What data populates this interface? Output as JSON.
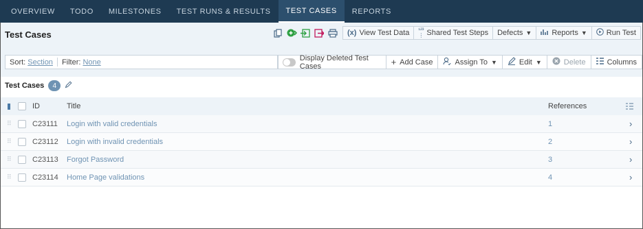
{
  "nav": {
    "tabs": [
      {
        "label": "OVERVIEW"
      },
      {
        "label": "TODO"
      },
      {
        "label": "MILESTONES"
      },
      {
        "label": "TEST RUNS & RESULTS"
      },
      {
        "label": "TEST CASES",
        "active": true
      },
      {
        "label": "REPORTS"
      }
    ]
  },
  "header": {
    "title": "Test Cases",
    "icons": [
      "copy-icon",
      "add-case-icon",
      "import-icon",
      "export-icon",
      "print-icon"
    ],
    "view_test_data": "View Test Data",
    "shared_test_steps": "Shared Test Steps",
    "defects": "Defects",
    "reports": "Reports",
    "run_test": "Run Test"
  },
  "toolbar": {
    "sort_label": "Sort:",
    "sort_value": "Section",
    "filter_label": "Filter:",
    "filter_value": "None",
    "display_deleted": "Display Deleted Test Cases",
    "add_case": "Add Case",
    "assign_to": "Assign To",
    "edit": "Edit",
    "delete": "Delete",
    "columns": "Columns"
  },
  "section": {
    "title": "Test Cases",
    "count": "4"
  },
  "table": {
    "headers": {
      "id": "ID",
      "title": "Title",
      "references": "References"
    },
    "rows": [
      {
        "id": "C23111",
        "title": "Login with valid credentials",
        "ref": "1"
      },
      {
        "id": "C23112",
        "title": "Login with invalid credentials",
        "ref": "2"
      },
      {
        "id": "C23113",
        "title": "Forgot Password",
        "ref": "3"
      },
      {
        "id": "C23114",
        "title": "Home Page validations",
        "ref": "4"
      }
    ]
  },
  "colors": {
    "nav_bg": "#1e3a52",
    "link": "#6f93b3",
    "add_icon_green": "#2ea043",
    "export_pink": "#c2185b"
  }
}
